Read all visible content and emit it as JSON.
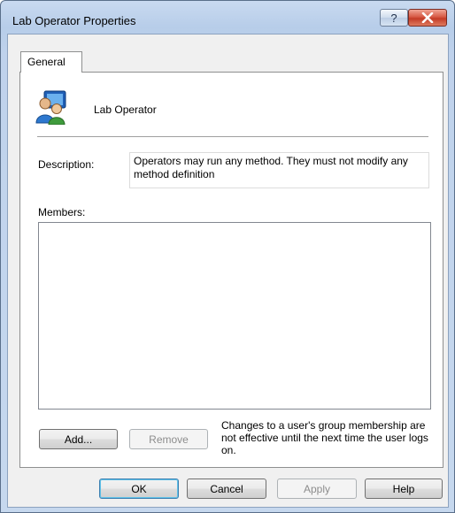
{
  "window": {
    "title": "Lab Operator Properties",
    "help_label": "?",
    "close_icon": "close-icon"
  },
  "tabs": [
    {
      "label": "General",
      "selected": true
    }
  ],
  "group": {
    "name": "Lab Operator",
    "icon": "group-users-icon"
  },
  "description": {
    "label": "Description:",
    "value": "Operators may run any method. They must not modify any method definition"
  },
  "members": {
    "label": "Members:",
    "items": []
  },
  "member_buttons": {
    "add": "Add...",
    "remove": "Remove"
  },
  "note": "Changes to a user's group membership are not effective until the next time the user logs on.",
  "dialog_buttons": {
    "ok": "OK",
    "cancel": "Cancel",
    "apply": "Apply",
    "help": "Help"
  },
  "colors": {
    "title_bar": "#c9daf0",
    "close_button": "#c43b26",
    "panel": "#ffffff",
    "dialog_bg": "#f0f0f0"
  }
}
